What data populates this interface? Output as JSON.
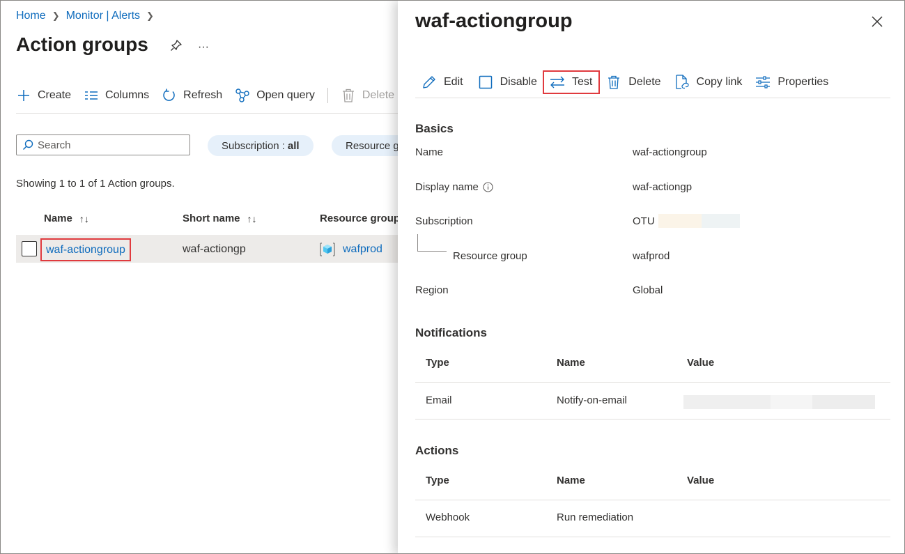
{
  "breadcrumb": {
    "home": "Home",
    "monitor": "Monitor | Alerts",
    "sep": ">"
  },
  "page": {
    "title": "Action groups",
    "pin_icon": "pin-icon",
    "more": "···"
  },
  "toolbar": {
    "create": "Create",
    "columns": "Columns",
    "refresh": "Refresh",
    "open_query": "Open query",
    "delete": "Delete"
  },
  "search": {
    "placeholder": "Search"
  },
  "filters": {
    "subscription_label": "Subscription :",
    "subscription_value": "all",
    "resource_group": "Resource g"
  },
  "grid": {
    "showing": "Showing 1 to 1 of 1 Action groups.",
    "columns": {
      "name": "Name",
      "short_name": "Short name",
      "resource_group": "Resource group"
    },
    "sort_glyph": "↑↓",
    "rows": [
      {
        "name": "waf-actiongroup",
        "short_name": "waf-actiongp",
        "resource_group": "wafprod"
      }
    ]
  },
  "panel": {
    "title": "waf-actiongroup",
    "toolbar": {
      "edit": "Edit",
      "disable": "Disable",
      "test": "Test",
      "delete": "Delete",
      "copy_link": "Copy link",
      "properties": "Properties"
    },
    "basics": {
      "heading": "Basics",
      "name_label": "Name",
      "name_value": "waf-actiongroup",
      "display_label": "Display name",
      "display_value": "waf-actiongp",
      "subscription_label": "Subscription",
      "subscription_value": "OTU",
      "rg_label": "Resource group",
      "rg_value": "wafprod",
      "region_label": "Region",
      "region_value": "Global"
    },
    "notifications": {
      "heading": "Notifications",
      "col_type": "Type",
      "col_name": "Name",
      "col_value": "Value",
      "rows": [
        {
          "type": "Email",
          "name": "Notify-on-email"
        }
      ]
    },
    "actions": {
      "heading": "Actions",
      "col_type": "Type",
      "col_name": "Name",
      "col_value": "Value",
      "rows": [
        {
          "type": "Webhook",
          "name": "Run remediation"
        }
      ]
    }
  },
  "colors": {
    "link": "#0f6cbd",
    "highlight_border": "#e03a3e",
    "pill_bg": "#e6f0fa",
    "row_selected_bg": "#edebe9"
  }
}
